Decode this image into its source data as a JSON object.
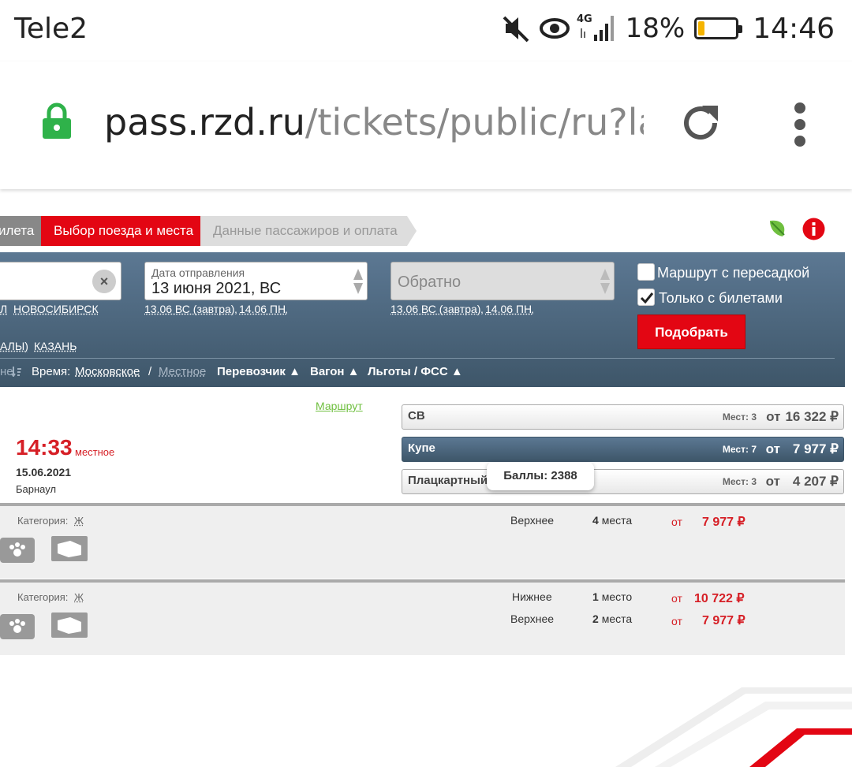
{
  "status_bar": {
    "carrier": "Tele2",
    "battery_percent": "18%",
    "battery_level": 0.18,
    "time": "14:46",
    "icons": [
      "mute-icon",
      "eye-icon",
      "signal-4g-icon",
      "battery-icon"
    ],
    "net_label": "4G"
  },
  "browser": {
    "url_host": "pass.rzd.ru",
    "url_path": "/tickets/public/ru?lay"
  },
  "breadcrumb": {
    "step1": "илета",
    "step2": "Выбор поезда и места",
    "step3": "Данные пассажиров и оплата"
  },
  "search": {
    "date_label": "Дата отправления",
    "date_value": "13 июня 2021, ВС",
    "return_placeholder": "Обратно",
    "from_links": [
      "Л",
      "НОВОСИБИРСК"
    ],
    "from_links2": [
      "АЛЫ)",
      "КАЗАНЬ"
    ],
    "date_quick": [
      "13.06 ВС (завтра)",
      "14.06 ПН"
    ],
    "return_quick": [
      "13.06 ВС (завтра)",
      "14.06 ПН"
    ],
    "transfer_label": "Маршрут с пересадкой",
    "transfer_checked": false,
    "only_tickets_label": "Только с билетами",
    "only_tickets_checked": true,
    "submit_label": "Подобрать"
  },
  "sort": {
    "cut_label": "не",
    "time_label": "Время:",
    "moscow": "Московское",
    "sep": "/",
    "local": "Местное",
    "carrier": "Перевозчик",
    "car": "Вагон",
    "benefits": "Льготы / ФСС"
  },
  "train": {
    "route_link": "Маршрут",
    "arrival_time": "14:33",
    "arrival_tz": "местное",
    "arrival_date": "15.06.2021",
    "arrival_city": "Барнаул"
  },
  "classes": [
    {
      "name": "СВ",
      "seats": "Мест: 3",
      "from": "от",
      "price": "16 322 ₽"
    },
    {
      "name": "Купе",
      "seats": "Мест: 7",
      "from": "от",
      "price": "7 977 ₽"
    },
    {
      "name": "Плацкартный",
      "seats": "Мест: 3",
      "from": "от",
      "price": "4 207 ₽"
    }
  ],
  "tooltip": "Баллы: 2388",
  "cars": [
    {
      "category_label": "Категория:",
      "category": "Ж",
      "lines": [
        {
          "berth": "Верхнее",
          "count": "4",
          "unit": "места",
          "from": "от",
          "price": "7 977 ₽"
        }
      ]
    },
    {
      "category_label": "Категория:",
      "category": "Ж",
      "lines": [
        {
          "berth": "Нижнее",
          "count": "1",
          "unit": "место",
          "from": "от",
          "price": "10 722 ₽"
        },
        {
          "berth": "Верхнее",
          "count": "2",
          "unit": "места",
          "from": "от",
          "price": "7 977 ₽"
        }
      ]
    }
  ],
  "colors": {
    "brand_red": "#e30613",
    "panel_blue": "#4a6378",
    "lock_green": "#2fb24a"
  }
}
